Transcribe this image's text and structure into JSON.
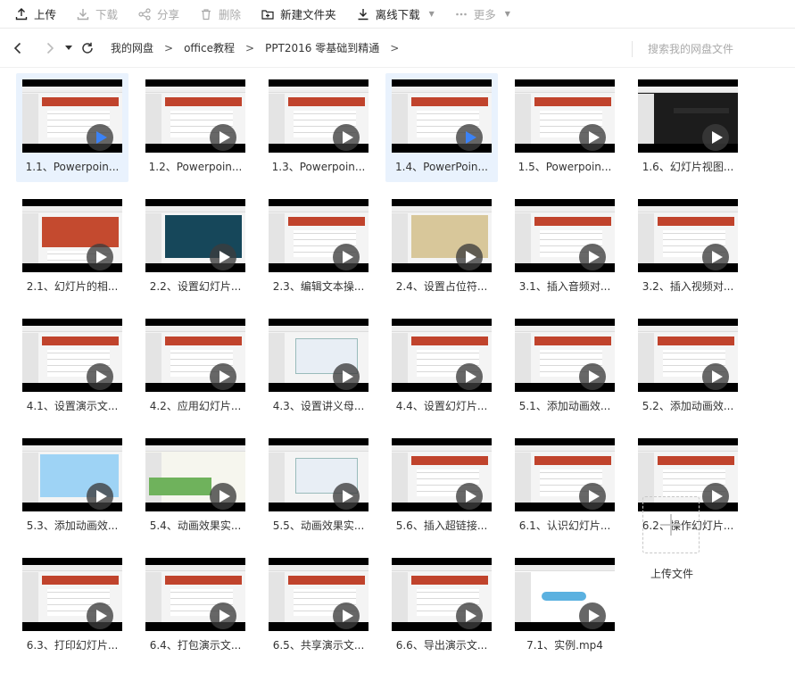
{
  "toolbar": {
    "upload": "上传",
    "download": "下载",
    "share": "分享",
    "delete": "删除",
    "new_folder": "新建文件夹",
    "offline_download": "离线下载",
    "more": "更多"
  },
  "breadcrumb": [
    "我的网盘",
    "office教程",
    "PPT2016 零基础到精通"
  ],
  "search": {
    "placeholder": "搜索我的网盘文件"
  },
  "files": [
    {
      "name": "1.1、Powerpoin...",
      "selected": true,
      "variant": "std"
    },
    {
      "name": "1.2、Powerpoin...",
      "selected": false,
      "variant": "std"
    },
    {
      "name": "1.3、Powerpoin...",
      "selected": false,
      "variant": "std"
    },
    {
      "name": "1.4、PowerPoin...",
      "selected": true,
      "variant": "std"
    },
    {
      "name": "1.5、Powerpoin...",
      "selected": false,
      "variant": "std"
    },
    {
      "name": "1.6、幻灯片视图...",
      "selected": false,
      "variant": "dark"
    },
    {
      "name": "2.1、幻灯片的相...",
      "selected": false,
      "variant": "big"
    },
    {
      "name": "2.2、设置幻灯片...",
      "selected": false,
      "variant": "teal"
    },
    {
      "name": "2.3、编辑文本操...",
      "selected": false,
      "variant": "std"
    },
    {
      "name": "2.4、设置占位符...",
      "selected": false,
      "variant": "parch"
    },
    {
      "name": "3.1、插入音频对...",
      "selected": false,
      "variant": "std"
    },
    {
      "name": "3.2、插入视频对...",
      "selected": false,
      "variant": "std"
    },
    {
      "name": "4.1、设置演示文...",
      "selected": false,
      "variant": "std"
    },
    {
      "name": "4.2、应用幻灯片...",
      "selected": false,
      "variant": "std"
    },
    {
      "name": "4.3、设置讲义母...",
      "selected": false,
      "variant": "ui"
    },
    {
      "name": "4.4、设置幻灯片...",
      "selected": false,
      "variant": "std"
    },
    {
      "name": "5.1、添加动画效...",
      "selected": false,
      "variant": "std"
    },
    {
      "name": "5.2、添加动画效...",
      "selected": false,
      "variant": "std"
    },
    {
      "name": "5.3、添加动画效...",
      "selected": false,
      "variant": "cartoon"
    },
    {
      "name": "5.4、动画效果实...",
      "selected": false,
      "variant": "green"
    },
    {
      "name": "5.5、动画效果实...",
      "selected": false,
      "variant": "ui"
    },
    {
      "name": "5.6、插入超链接...",
      "selected": false,
      "variant": "std"
    },
    {
      "name": "6.1、认识幻灯片...",
      "selected": false,
      "variant": "std"
    },
    {
      "name": "6.2、操作幻灯片...",
      "selected": false,
      "variant": "std"
    },
    {
      "name": "6.3、打印幻灯片...",
      "selected": false,
      "variant": "std"
    },
    {
      "name": "6.4、打包演示文...",
      "selected": false,
      "variant": "std"
    },
    {
      "name": "6.5、共享演示文...",
      "selected": false,
      "variant": "std"
    },
    {
      "name": "6.6、导出演示文...",
      "selected": false,
      "variant": "std"
    },
    {
      "name": "7.1、实例.mp4",
      "selected": false,
      "variant": "diagram"
    }
  ],
  "upload_tile": {
    "label": "上传文件"
  },
  "colors": {
    "accent": "#3b82f6",
    "selected_bg": "#e9f2fd",
    "slide_red": "#c0432c"
  }
}
